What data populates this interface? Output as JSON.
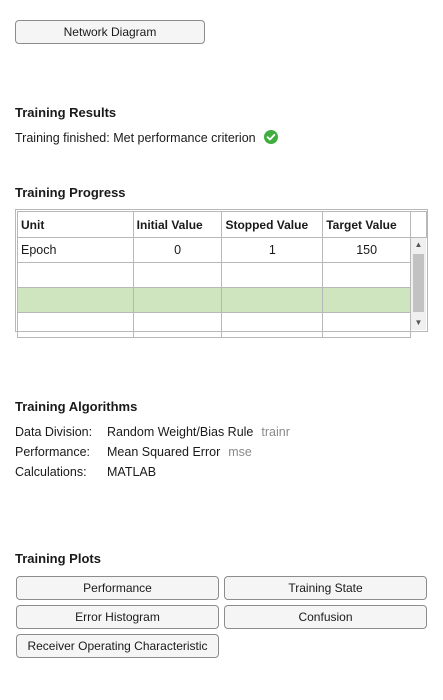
{
  "toolbar": {
    "network_diagram_label": "Network Diagram"
  },
  "training_results": {
    "title": "Training Results",
    "status": "Training finished: Met performance criterion",
    "status_icon": "check-circle-icon",
    "status_color": "#3fae3f"
  },
  "training_progress": {
    "title": "Training Progress",
    "columns": [
      "Unit",
      "Initial Value",
      "Stopped Value",
      "Target Value"
    ],
    "rows": [
      {
        "unit": "Epoch",
        "initial": "0",
        "stopped": "1",
        "target": "150"
      }
    ],
    "highlight_color": "#cfe5c0"
  },
  "training_algorithms": {
    "title": "Training Algorithms",
    "items": [
      {
        "label": "Data Division:",
        "value": "Random Weight/Bias Rule",
        "fn": "trainr"
      },
      {
        "label": "Performance:",
        "value": "Mean Squared Error",
        "fn": "mse"
      },
      {
        "label": "Calculations:",
        "value": "MATLAB",
        "fn": ""
      }
    ]
  },
  "training_plots": {
    "title": "Training Plots",
    "buttons": {
      "performance": "Performance",
      "training_state": "Training State",
      "error_histogram": "Error Histogram",
      "confusion": "Confusion",
      "roc": "Receiver Operating Characteristic"
    }
  }
}
